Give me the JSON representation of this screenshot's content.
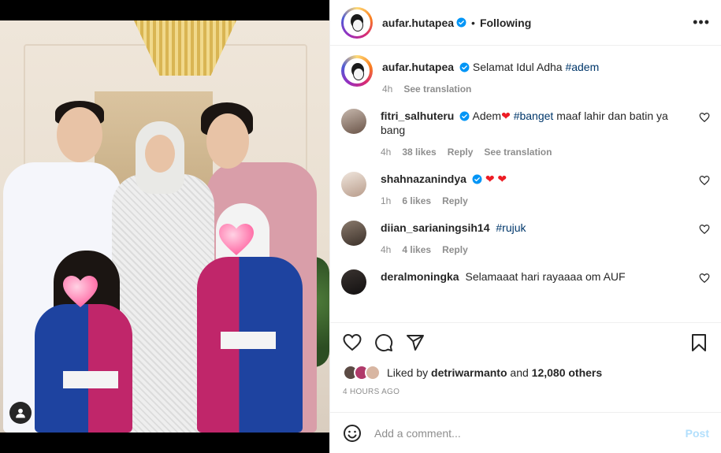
{
  "post": {
    "author": "aufar.hutapea",
    "follow_status": "Following",
    "more_label": "•••",
    "caption_text": "Selamat Idul Adha",
    "caption_tag": "#adem",
    "caption_time": "4h",
    "caption_see_translation": "See translation"
  },
  "comments": [
    {
      "user": "fitri_salhuteru",
      "verified": true,
      "text_before": "Adem",
      "emoji": "❤",
      "tag": "#banget",
      "text_after": "maaf lahir dan batin ya bang",
      "time": "4h",
      "likes": "38 likes",
      "reply": "Reply",
      "see_translation": "See translation"
    },
    {
      "user": "shahnazanindya",
      "verified": true,
      "emoji": "❤ ❤",
      "time": "1h",
      "likes": "6 likes",
      "reply": "Reply"
    },
    {
      "user": "diian_sarianingsih14",
      "verified": false,
      "tag": "#rujuk",
      "time": "4h",
      "likes": "4 likes",
      "reply": "Reply"
    },
    {
      "user": "deralmoningka",
      "verified": false,
      "text": "Selamaaat hari rayaaaa om AUF"
    }
  ],
  "likes": {
    "prefix": "Liked by",
    "first_liker": "detriwarmanto",
    "connector": "and",
    "others": "12,080 others"
  },
  "timestamp": "4 HOURS AGO",
  "add_comment": {
    "placeholder": "Add a comment...",
    "post_label": "Post"
  },
  "icons": {
    "like": "heart-icon",
    "comment": "comment-icon",
    "share": "share-icon",
    "save": "bookmark-icon",
    "emoji": "emoji-icon",
    "verified": "verified-badge-icon",
    "user_tag": "user-tag-icon"
  },
  "colors": {
    "link_blue": "#00376b",
    "verified_blue": "#0095f6",
    "post_disabled": "#b2dffc",
    "heart_red": "#ed1c24",
    "muted": "#8e8e8e"
  }
}
